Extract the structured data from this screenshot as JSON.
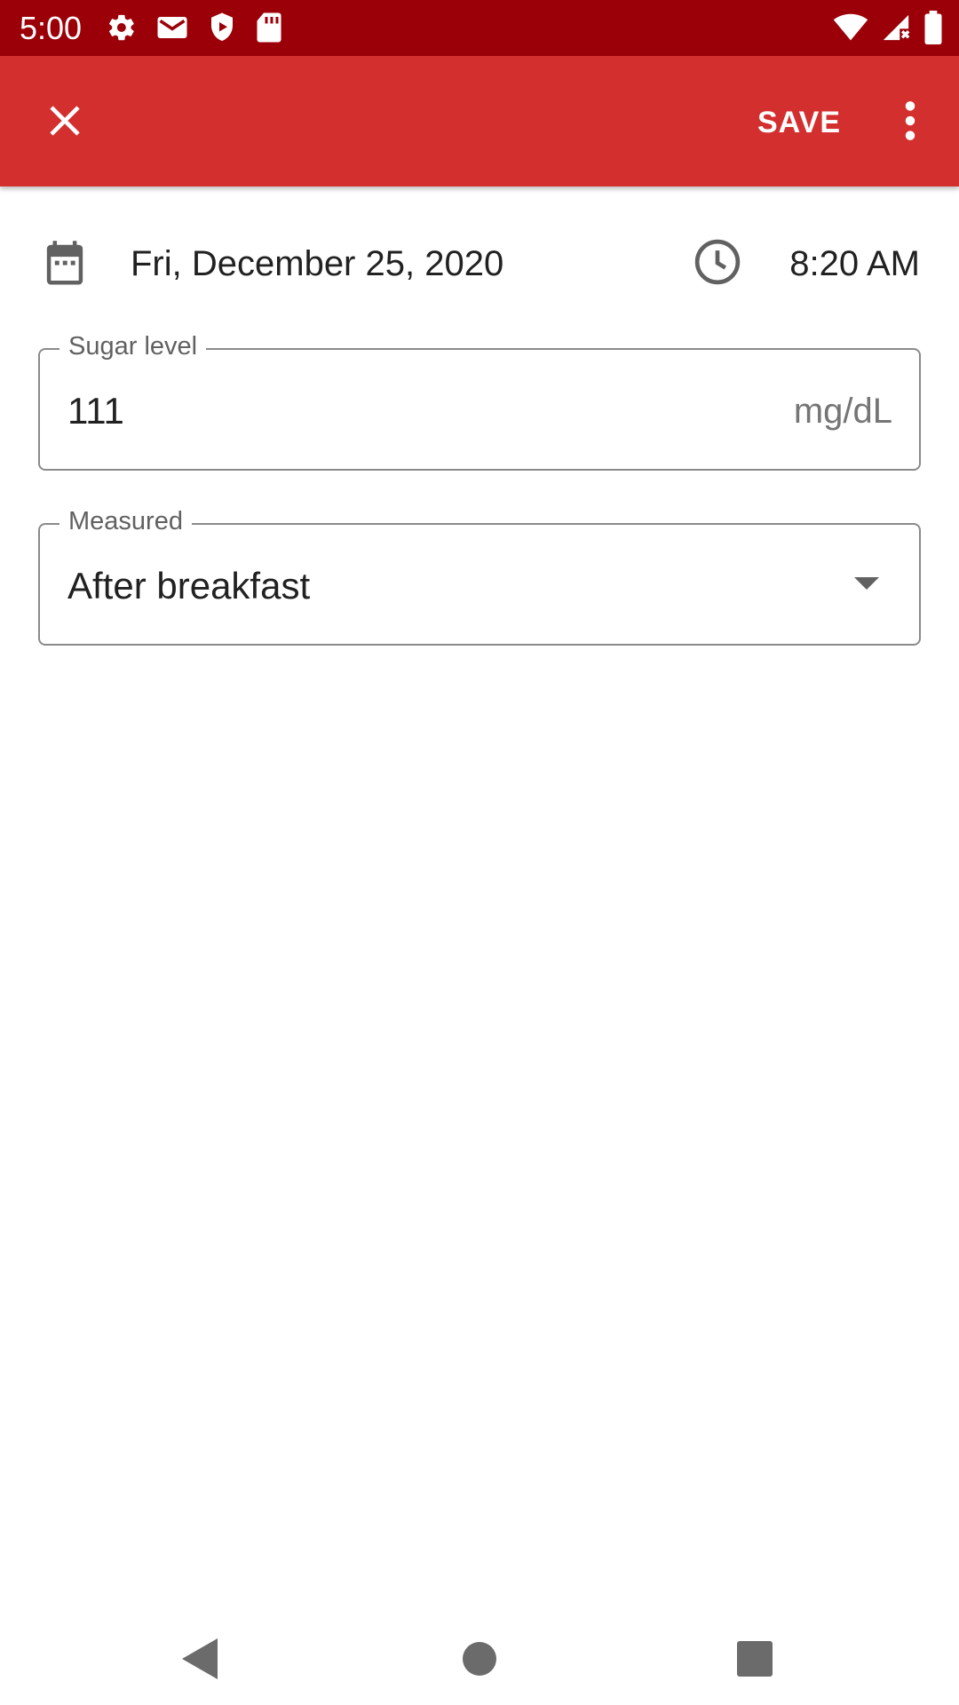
{
  "status_bar": {
    "time": "5:00",
    "left_icons": [
      "settings-icon",
      "gmail-icon",
      "shield-play-icon",
      "sd-card-icon"
    ],
    "right_icons": [
      "wifi-icon",
      "signal-icon",
      "battery-icon"
    ]
  },
  "app_bar": {
    "close_icon": "close-icon",
    "save_label": "SAVE",
    "overflow_icon": "more-vert-icon",
    "color": "#d32f2f"
  },
  "entry": {
    "date": "Fri, December 25, 2020",
    "time": "8:20 AM"
  },
  "sugar_field": {
    "label": "Sugar level",
    "value": "111",
    "unit": "mg/dL"
  },
  "measured_field": {
    "label": "Measured",
    "value": "After breakfast"
  },
  "nav_bar": {
    "buttons": [
      "back-icon",
      "home-icon",
      "recents-icon"
    ]
  }
}
